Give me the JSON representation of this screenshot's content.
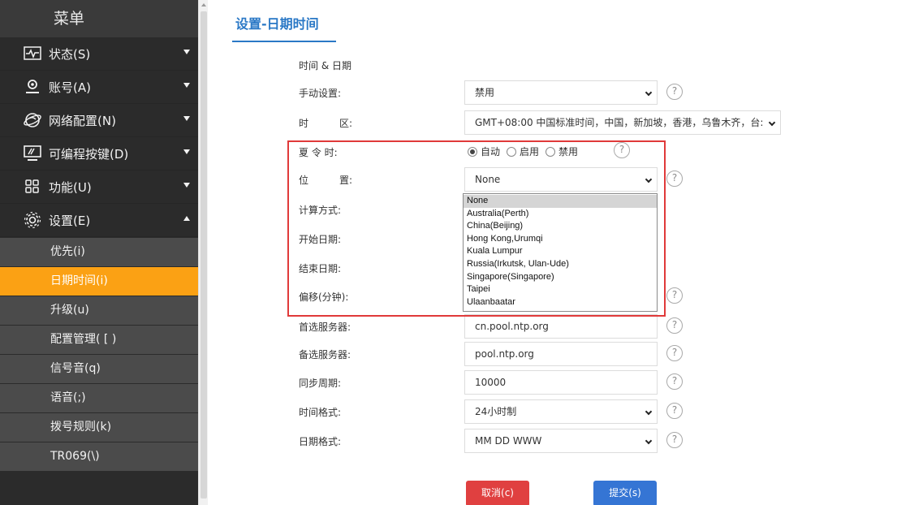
{
  "sidebar": {
    "title": "菜单",
    "categories": [
      {
        "label": "状态(S)",
        "icon": "status-icon",
        "expanded": false
      },
      {
        "label": "账号(A)",
        "icon": "account-icon",
        "expanded": false
      },
      {
        "label": "网络配置(N)",
        "icon": "network-icon",
        "expanded": false
      },
      {
        "label": "可编程按键(D)",
        "icon": "programmable-keys-icon",
        "expanded": false
      },
      {
        "label": "功能(U)",
        "icon": "features-icon",
        "expanded": false
      },
      {
        "label": "设置(E)",
        "icon": "settings-gear-icon",
        "expanded": true
      }
    ],
    "settings_items": [
      {
        "label": "优先(i)",
        "active": false
      },
      {
        "label": "日期时间(i)",
        "active": true
      },
      {
        "label": "升级(u)",
        "active": false
      },
      {
        "label": "配置管理( [ )",
        "active": false
      },
      {
        "label": "信号音(q)",
        "active": false
      },
      {
        "label": "语音(;)",
        "active": false
      },
      {
        "label": "拨号规则(k)",
        "active": false
      },
      {
        "label": "TR069(\\)",
        "active": false
      }
    ]
  },
  "main": {
    "title": "设置-日期时间",
    "section_label": "时间 & 日期",
    "manual": {
      "label": "手动设置:",
      "value": "禁用"
    },
    "timezone": {
      "label_left": "时",
      "label_right": "区:",
      "value": "GMT+08:00 中国标准时间，中国，新加坡，香港，乌鲁木齐，台:"
    },
    "dst": {
      "label": "夏 令 时:",
      "options": [
        "自动",
        "启用",
        "禁用"
      ],
      "selected": "自动"
    },
    "location": {
      "label_left": "位",
      "label_right": "置:",
      "value": "None"
    },
    "calc_method": {
      "label": "计算方式:"
    },
    "start_date": {
      "label": "开始日期:"
    },
    "end_date": {
      "label": "结束日期:"
    },
    "offset": {
      "label": "偏移(分钟):"
    },
    "primary_server": {
      "label": "首选服务器:",
      "value": "cn.pool.ntp.org"
    },
    "secondary_server": {
      "label": "备选服务器:",
      "value": "pool.ntp.org"
    },
    "sync_period": {
      "label": "同步周期:",
      "value": "10000"
    },
    "time_format": {
      "label": "时间格式:",
      "value": "24小时制"
    },
    "date_format": {
      "label": "日期格式:",
      "value": "MM DD WWW"
    },
    "help_symbol": "?",
    "cancel_label": "取消(c)",
    "submit_label": "提交(s)"
  },
  "location_dropdown": {
    "options": [
      "None",
      "Australia(Perth)",
      "China(Beijing)",
      "Hong Kong,Urumqi",
      "Kuala Lumpur",
      "Russia(Irkutsk, Ulan-Ude)",
      "Singapore(Singapore)",
      "Taipei",
      "Ulaanbaatar"
    ],
    "selected": "None"
  },
  "colors": {
    "accent": "#2a78c6",
    "active_menu": "#fba114",
    "sidebar_bg": "#2b2b2b",
    "cancel": "#e04040",
    "submit": "#3575d4",
    "highlight": "#e03a3a"
  }
}
